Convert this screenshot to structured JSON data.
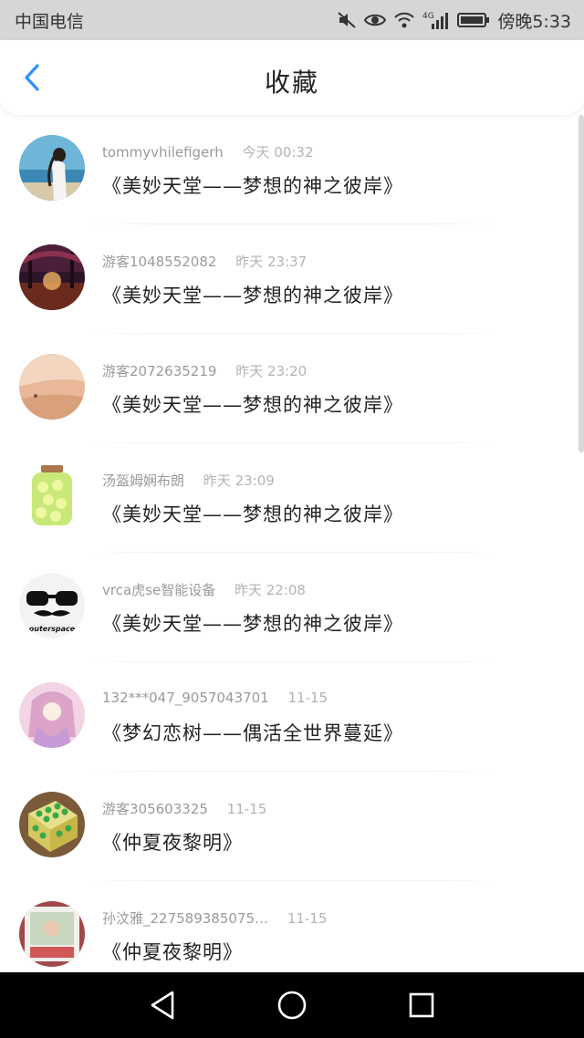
{
  "status_bar": {
    "carrier": "中国电信",
    "network": "4G",
    "time": "傍晚5:33",
    "icons": [
      "mute-icon",
      "eye-icon",
      "wifi-icon",
      "signal-icon",
      "battery-icon"
    ]
  },
  "header": {
    "title": "收藏",
    "back_icon": "chevron-left-icon",
    "accent_color": "#2f8fff"
  },
  "items": [
    {
      "name": "tommyvhilefigerh",
      "time": "今天 00:32",
      "title": "《美妙天堂——梦想的神之彼岸》"
    },
    {
      "name": "游客1048552082",
      "time": "昨天 23:37",
      "title": "《美妙天堂——梦想的神之彼岸》"
    },
    {
      "name": "游客2072635219",
      "time": "昨天 23:20",
      "title": "《美妙天堂——梦想的神之彼岸》"
    },
    {
      "name": "汤盔姆娴布朗",
      "time": "昨天 23:09",
      "title": "《美妙天堂——梦想的神之彼岸》"
    },
    {
      "name": "vrca虎se智能设备",
      "time": "昨天 22:08",
      "title": "《美妙天堂——梦想的神之彼岸》"
    },
    {
      "name": "132***047_9057043701",
      "time": "11-15",
      "title": "《梦幻恋树——偶活全世界蔓延》"
    },
    {
      "name": "游客305603325",
      "time": "11-15",
      "title": "《仲夏夜黎明》"
    },
    {
      "name": "孙汶雅_227589385075…",
      "time": "11-15",
      "title": "《仲夏夜黎明》"
    }
  ],
  "avatar_brand_text": "outerspace",
  "nav": {
    "icons": [
      "back-triangle-icon",
      "home-circle-icon",
      "recents-square-icon"
    ]
  }
}
